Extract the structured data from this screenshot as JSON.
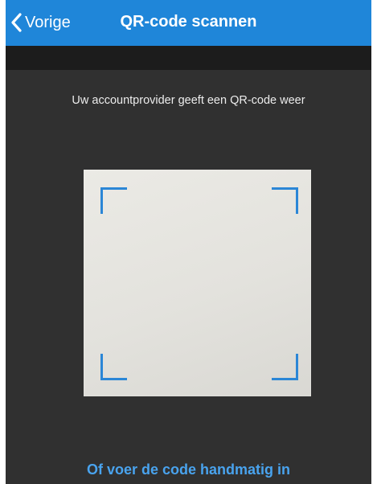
{
  "navbar": {
    "back_label": "Vorige",
    "title": "QR-code scannen",
    "back_icon": "chevron-left-icon"
  },
  "scanner": {
    "instruction": "Uw accountprovider geeft een QR-code weer"
  },
  "footer": {
    "manual_entry_link": "Of voer de code handmatig in"
  },
  "colors": {
    "navbar_background": "#1f86d9",
    "screen_background": "#303030",
    "subheader_band": "#1c1c1c",
    "viewfinder_corners": "#2b86d6",
    "link": "#49a3ee"
  }
}
